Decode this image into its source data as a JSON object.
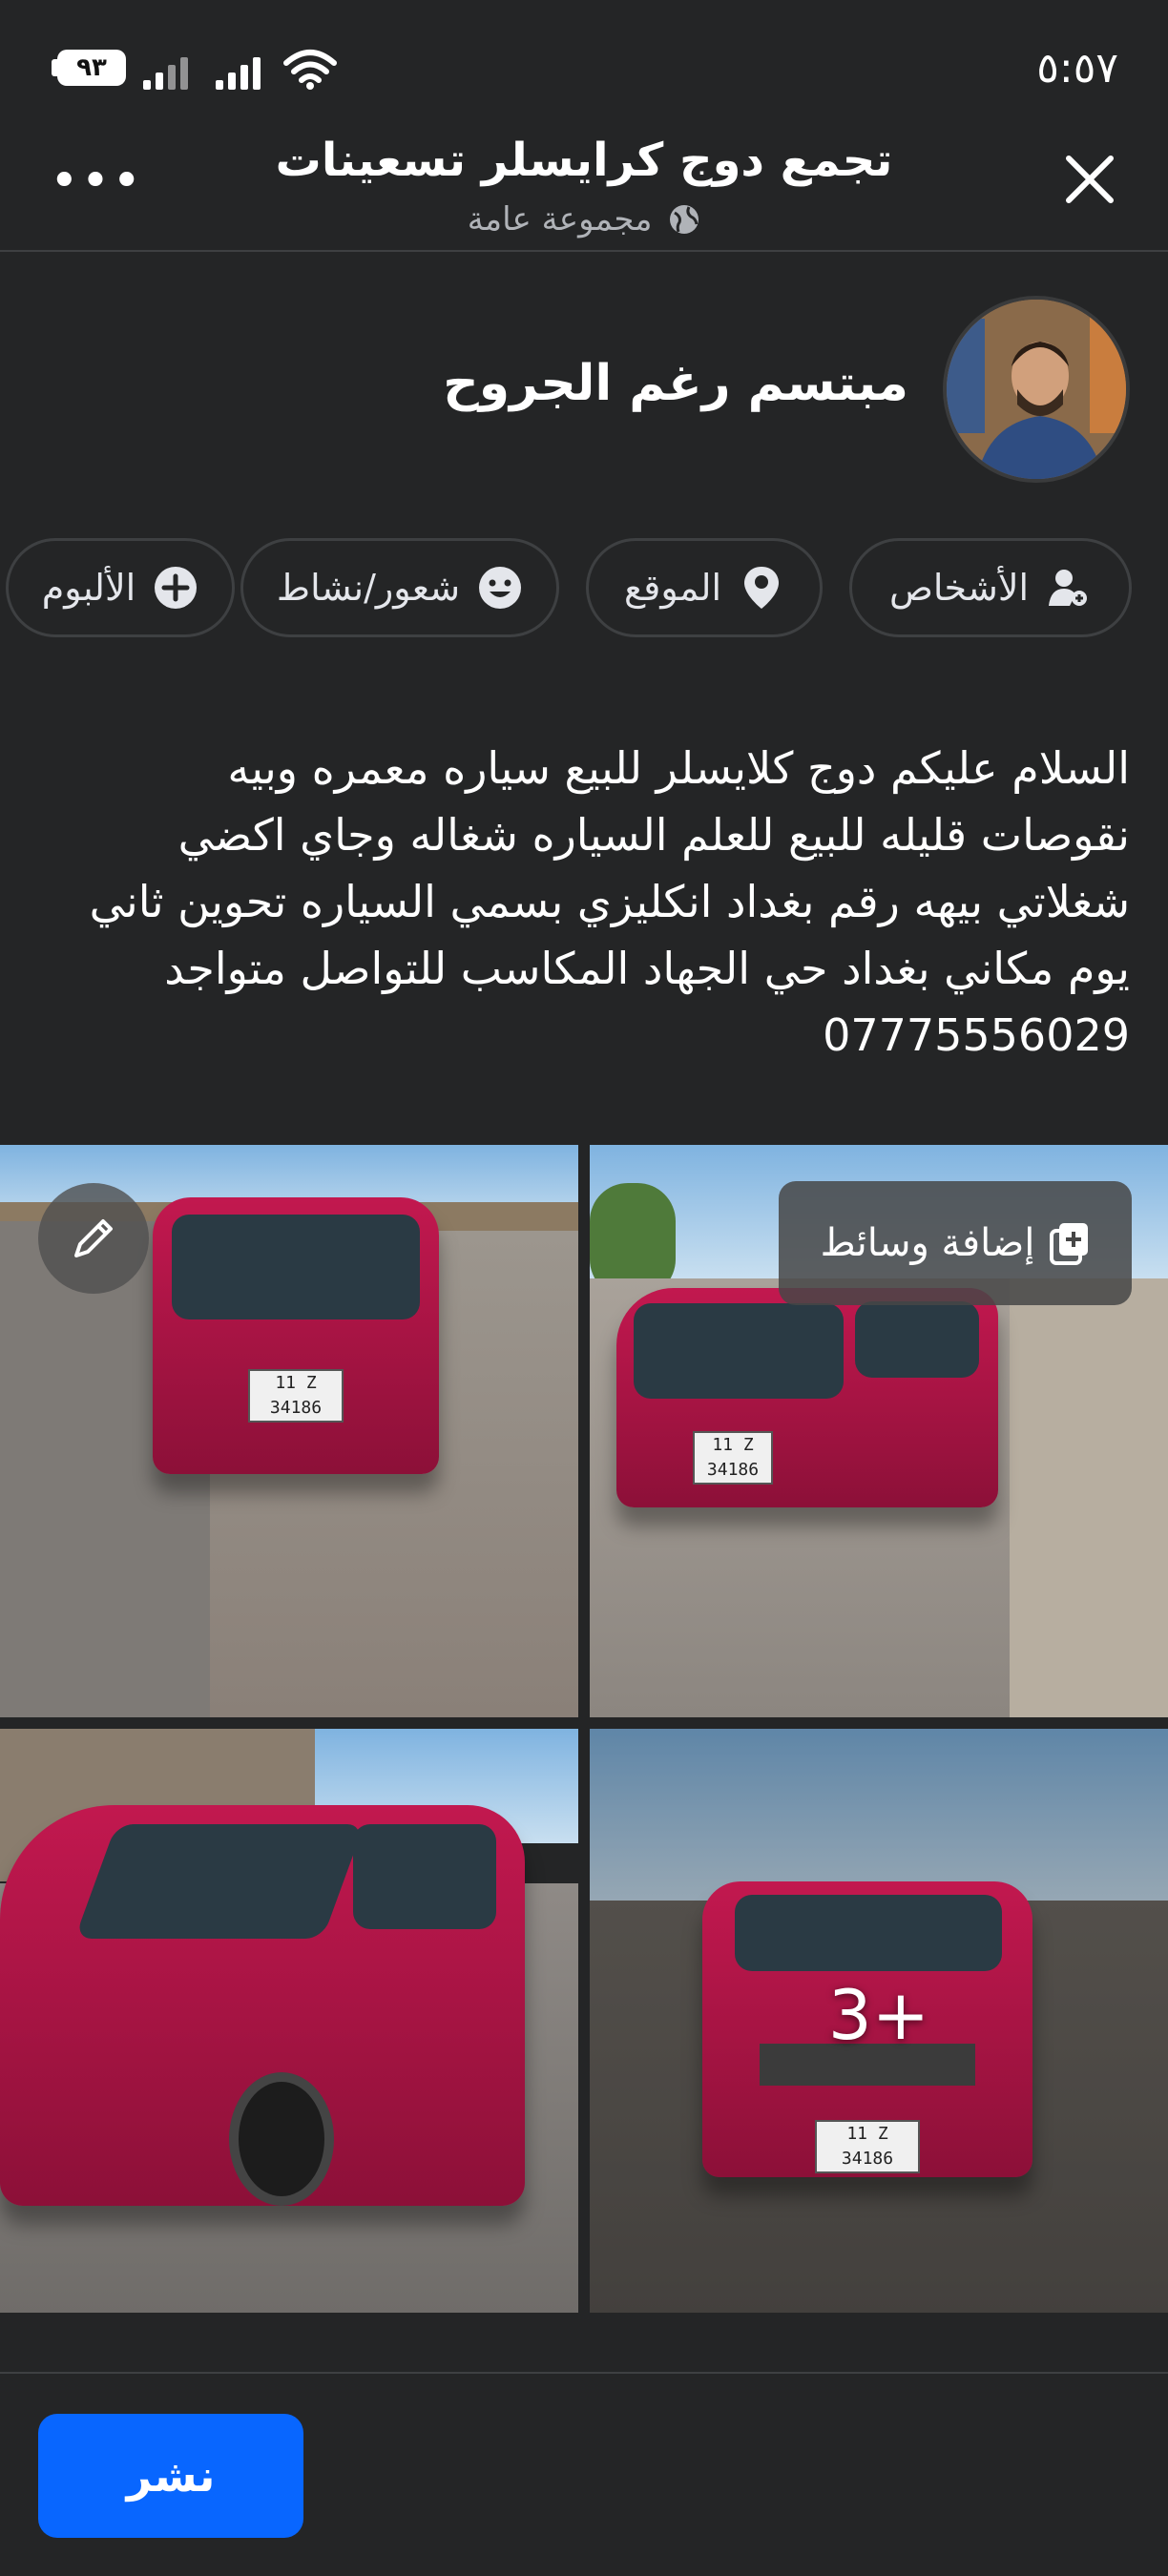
{
  "status_bar": {
    "time": "٥:٥٧",
    "battery": "٩٣"
  },
  "header": {
    "title": "تجمع دوج كرايسلر تسعينات",
    "subtitle": "مجموعة عامة",
    "more_icon": "more-dots-icon",
    "close_icon": "close-icon"
  },
  "author": {
    "name": "مبتسم رغم الجروح"
  },
  "chips": [
    {
      "label": "الأشخاص",
      "icon": "tag-people-icon"
    },
    {
      "label": "الموقع",
      "icon": "location-pin-icon"
    },
    {
      "label": "شعور/نشاط",
      "icon": "smiley-icon"
    },
    {
      "label": "الألبوم",
      "icon": "plus-circle-icon"
    }
  ],
  "post": {
    "text": "السلام عليكم دوج كلايسلر للبيع سياره معمره وبيه\nنقوصات قليله للبيع للعلم السياره شغاله وجاي اكضي\nشغلاتي بيهه رقم بغداد انكليزي بسمي السياره تحوين ثاني\nيوم مكاني بغداد حي الجهاد المكاسب  للتواصل متواجد\n07775556029"
  },
  "media": {
    "add_media_label": "إضافة وسائط",
    "more_count": "3+",
    "plates": [
      "11 Z 34186",
      "11 Z 34186",
      "11 Z 34186"
    ]
  },
  "footer": {
    "post_button": "نشر"
  },
  "colors": {
    "background": "#242526",
    "accent": "#0866ff",
    "van": "#c2184f"
  }
}
